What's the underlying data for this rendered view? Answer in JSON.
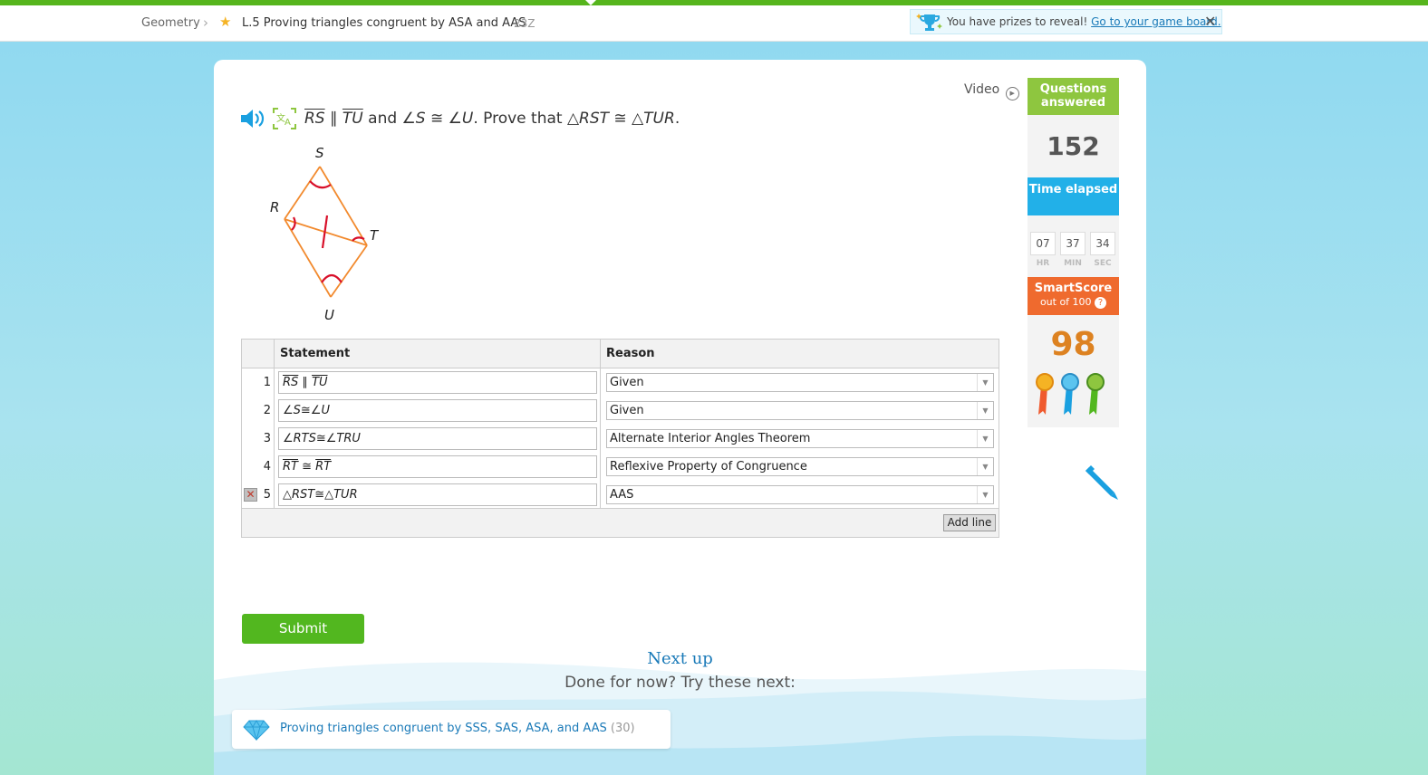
{
  "breadcrumb": {
    "subject": "Geometry",
    "skill": "L.5 Proving triangles congruent by ASA and AAS",
    "code": "23Z"
  },
  "prize_banner": {
    "text": "You have prizes to reveal!",
    "link": "Go to your game board."
  },
  "video_label": "Video",
  "question": {
    "seg1": "RS",
    "par": " ∥ ",
    "seg2": "TU",
    "mid": " and ",
    "angles": "∠S ≅ ∠U",
    "prove": ". Prove that ",
    "tri1": "△RST",
    "cong": " ≅ ",
    "tri2": "△TUR",
    "end": "."
  },
  "figure": {
    "labels": {
      "S": "S",
      "R": "R",
      "T": "T",
      "U": "U"
    },
    "colors": {
      "lines": "#f28a2e",
      "marks": "#d8102a"
    }
  },
  "proof": {
    "headers": {
      "statement": "Statement",
      "reason": "Reason"
    },
    "rows": [
      {
        "num": "1",
        "statement": "RS ∥ TU",
        "reason": "Given"
      },
      {
        "num": "2",
        "statement": "∠S≅∠U",
        "reason": "Given"
      },
      {
        "num": "3",
        "statement": "∠RTS≅∠TRU",
        "reason": "Alternate Interior Angles Theorem"
      },
      {
        "num": "4",
        "statement": "RT ≅ RT",
        "reason": "Reflexive Property of Congruence"
      },
      {
        "num": "5",
        "statement": "△RST≅△TUR",
        "reason": "AAS"
      }
    ],
    "add_line": "Add line"
  },
  "submit_label": "Submit",
  "next_up": {
    "title": "Next up",
    "subtitle": "Done for now? Try these next:",
    "suggestion": "Proving triangles congruent by SSS, SAS, ASA, and AAS",
    "suggestion_count": "(30)"
  },
  "sidebar": {
    "questions_label": "Questions answered",
    "questions_value": "152",
    "time_label": "Time elapsed",
    "time": {
      "hr": "07",
      "min": "37",
      "sec": "34"
    },
    "time_units": {
      "hr": "HR",
      "min": "MIN",
      "sec": "SEC"
    },
    "smartscore_label": "SmartScore",
    "smartscore_sub": "out of 100",
    "smartscore_help": "?",
    "smartscore_value": "98"
  },
  "colors": {
    "brand_green": "#52b71f",
    "sidebar_green": "#8ec63f",
    "sidebar_blue": "#22b0e8",
    "sidebar_orange": "#ef6a2e",
    "score_orange": "#dd8221",
    "link_blue": "#1a7ab8"
  }
}
